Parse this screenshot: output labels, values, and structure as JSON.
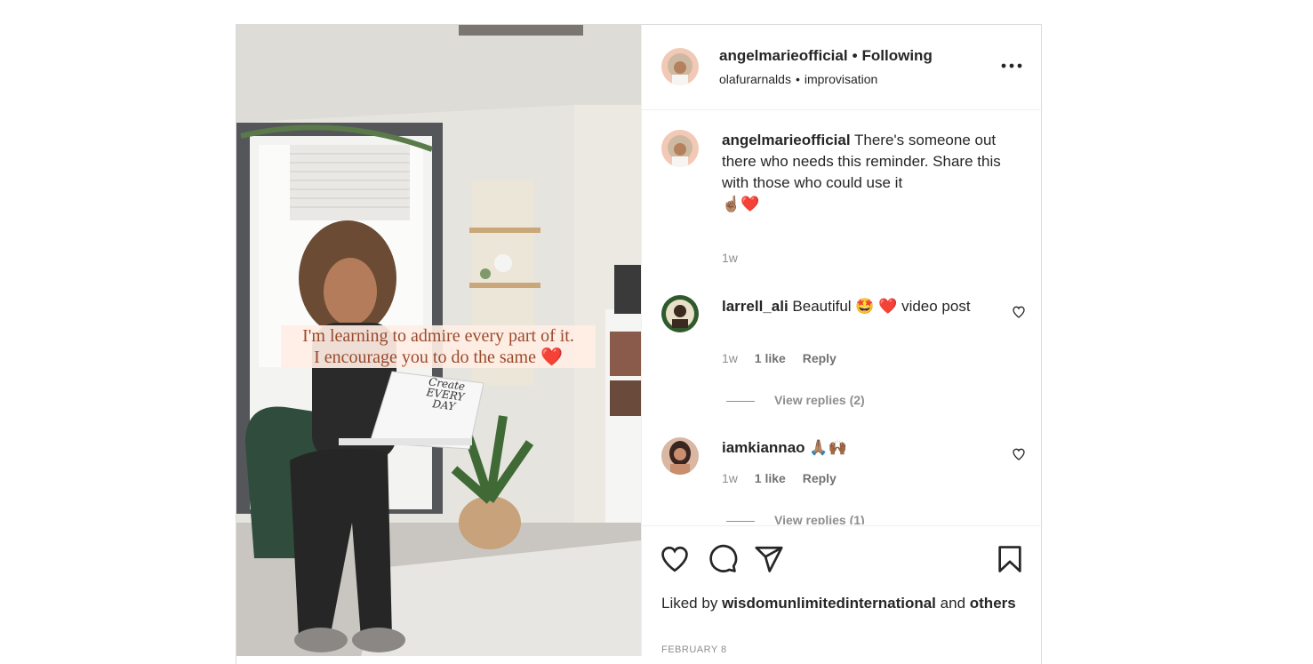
{
  "post": {
    "overlay_line1": "I'm learning to admire every part of it.",
    "overlay_line2": "I encourage you to do the same ❤️",
    "laptop_text": "Create EVERY DAY"
  },
  "header": {
    "username": "angelmarieofficial",
    "separator": "•",
    "follow_status": "Following",
    "audio_artist": "olafurarnalds",
    "audio_track": "improvisation"
  },
  "caption": {
    "username": "angelmarieofficial",
    "text": "There's someone out there who needs this reminder. Share this with those who could use it",
    "emojis": "☝🏽❤️",
    "time": "1w"
  },
  "comments": [
    {
      "username": "larrell_ali",
      "text": "Beautiful 🤩 ❤️ video post",
      "time": "1w",
      "likes": "1 like",
      "reply": "Reply",
      "view_replies": "View replies (2)"
    },
    {
      "username": "iamkiannao",
      "text": "🙏🏽🙌🏾",
      "time": "1w",
      "likes": "1 like",
      "reply": "Reply",
      "view_replies": "View replies (1)"
    }
  ],
  "likes": {
    "prefix": "Liked by",
    "user": "wisdomunlimitedinternational",
    "and": "and",
    "others": "others"
  },
  "date": "FEBRUARY 8",
  "icons": [
    "more-icon",
    "heart-icon",
    "comment-icon",
    "share-icon",
    "bookmark-icon"
  ],
  "colors": {
    "text": "#262626",
    "muted": "#8e8e8e",
    "border": "#dbdbdb",
    "overlay_text": "#9a4a2c"
  }
}
